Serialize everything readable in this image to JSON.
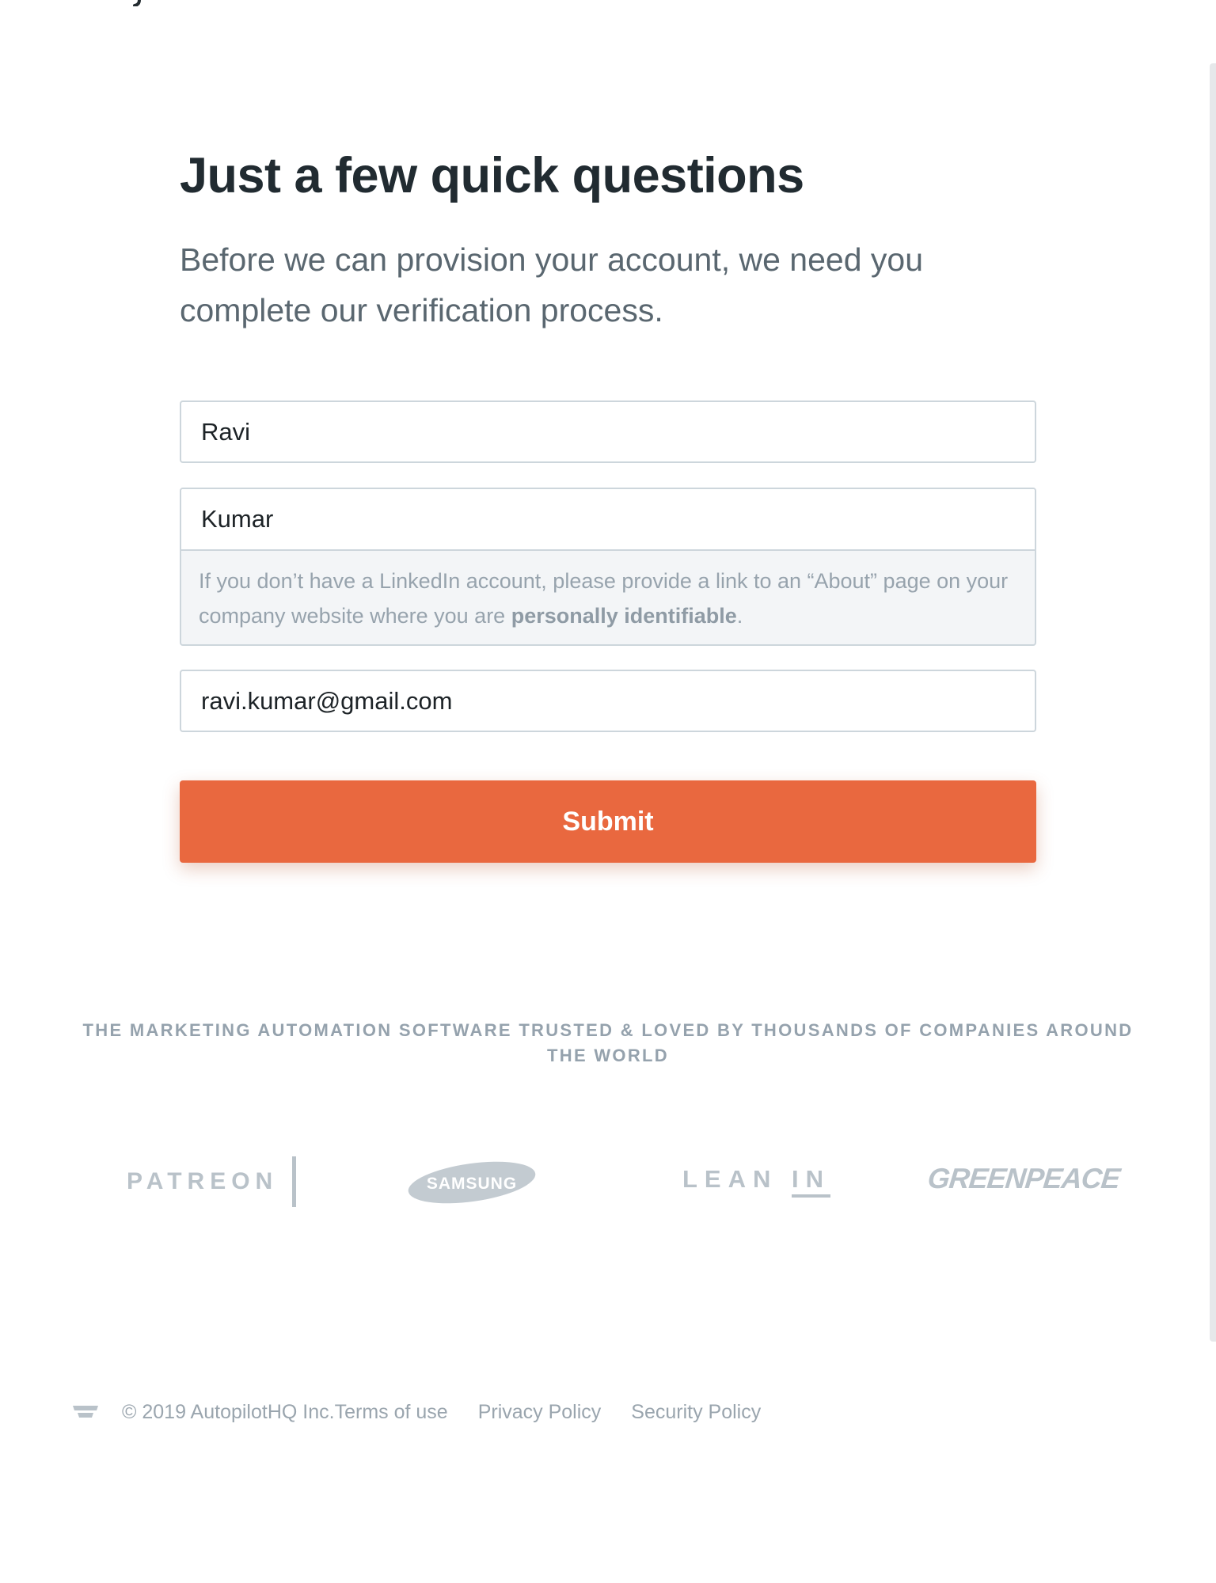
{
  "page": {
    "title": "Just a few quick questions",
    "subtitle": "Before we can provision your account, we need you complete our verification process."
  },
  "form": {
    "first_name": {
      "value": "Ravi"
    },
    "last_name": {
      "value": "Kumar"
    },
    "linkedin_help": {
      "text_before": "If you don’t have a LinkedIn account, please provide a link to an “About” page on your company website where you are ",
      "emphasis": "personally identifiable",
      "text_after": "."
    },
    "email": {
      "value": "ravi.kumar@gmail.com"
    },
    "submit_label": "Submit"
  },
  "trusted": {
    "tagline": "THE MARKETING AUTOMATION SOFTWARE TRUSTED & LOVED BY THOUSANDS OF COMPANIES AROUND THE WORLD",
    "logos": {
      "patreon": "PATREON",
      "samsung": "SAMSUNG",
      "leanin_lean": "LEAN",
      "leanin_in": "IN",
      "greenpeace": "GREENPEACE"
    }
  },
  "footer": {
    "copyright": "© 2019 AutopilotHQ Inc.",
    "terms": "Terms of use",
    "privacy": "Privacy Policy",
    "security": "Security Policy"
  },
  "colors": {
    "accent": "#e9683f",
    "heading": "#212b31",
    "muted": "#95a2ad",
    "logo_gray": "#b9c2c9"
  }
}
